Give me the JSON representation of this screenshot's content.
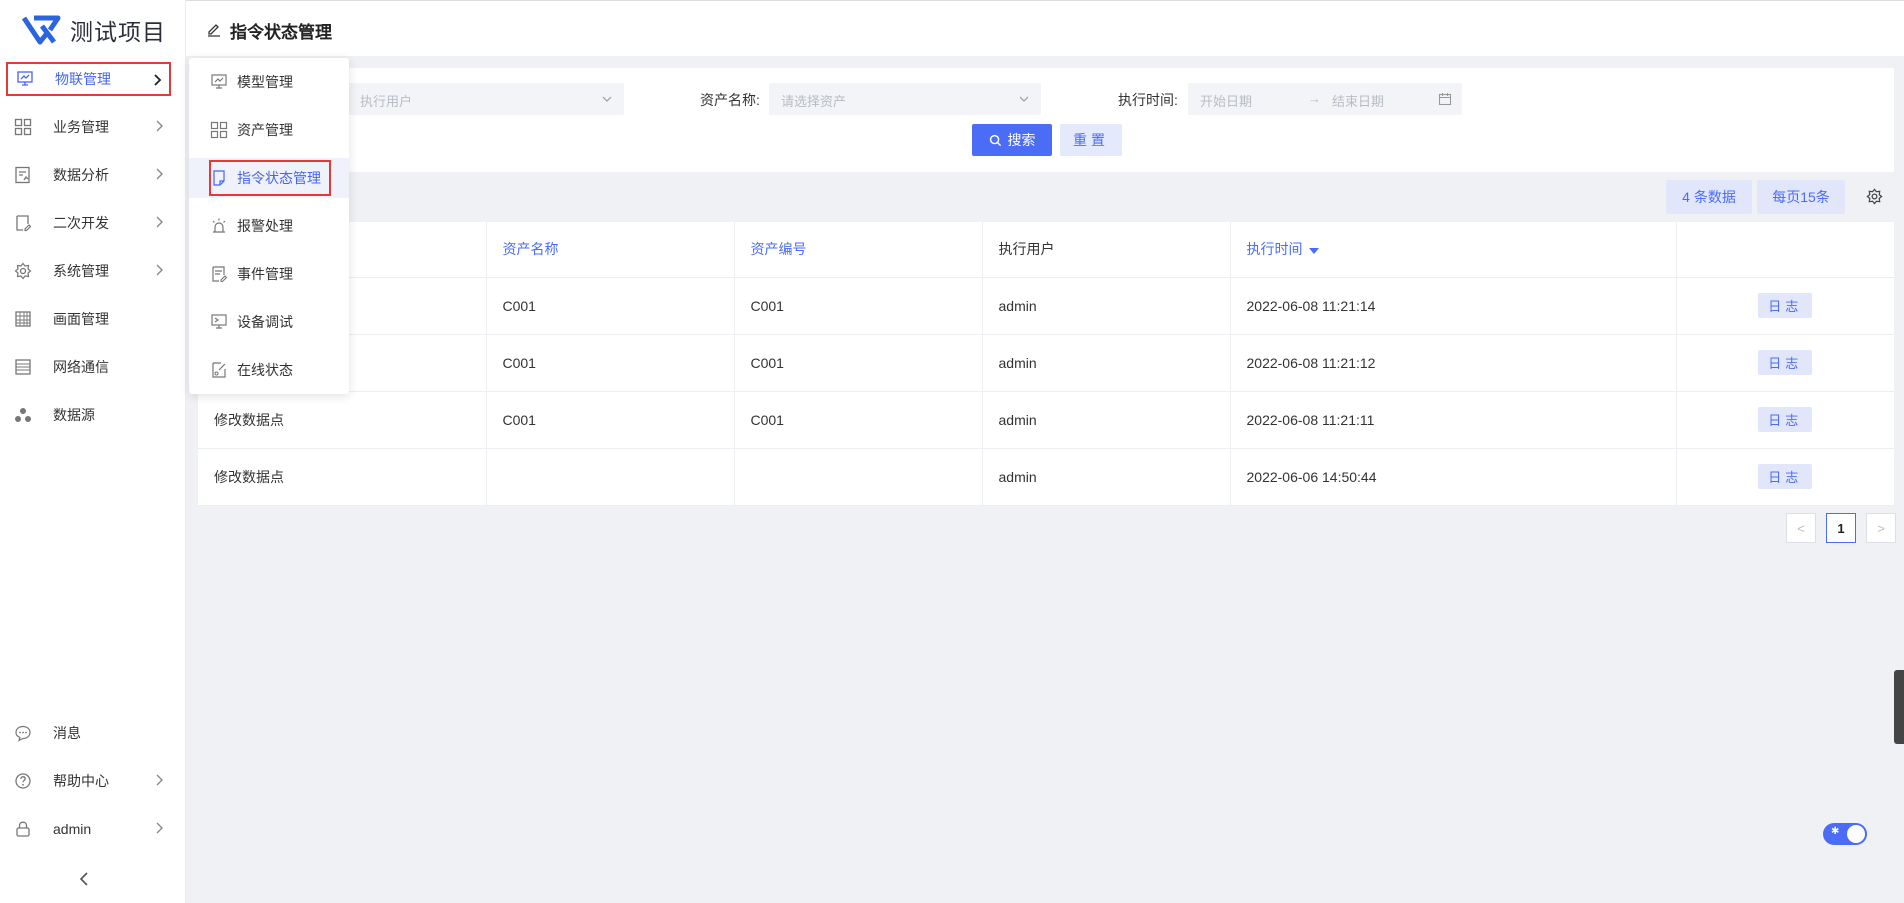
{
  "app": {
    "name": "测试项目"
  },
  "sidebar": {
    "items": [
      {
        "label": "物联管理",
        "icon": "iot-icon",
        "has_children": true,
        "active": true
      },
      {
        "label": "业务管理",
        "icon": "grid-icon",
        "has_children": true
      },
      {
        "label": "数据分析",
        "icon": "chart-doc-icon",
        "has_children": true
      },
      {
        "label": "二次开发",
        "icon": "dev-doc-icon",
        "has_children": true
      },
      {
        "label": "系统管理",
        "icon": "gear-icon",
        "has_children": true
      },
      {
        "label": "画面管理",
        "icon": "table-icon",
        "has_children": false
      },
      {
        "label": "网络通信",
        "icon": "list-icon",
        "has_children": false
      },
      {
        "label": "数据源",
        "icon": "cluster-icon",
        "has_children": false
      }
    ],
    "bottom": [
      {
        "label": "消息",
        "icon": "message-icon",
        "has_children": false
      },
      {
        "label": "帮助中心",
        "icon": "help-icon",
        "has_children": true
      },
      {
        "label": "admin",
        "icon": "lock-icon",
        "has_children": true
      }
    ]
  },
  "submenu": {
    "items": [
      {
        "label": "模型管理",
        "icon": "monitor-icon"
      },
      {
        "label": "资产管理",
        "icon": "grid-icon"
      },
      {
        "label": "指令状态管理",
        "icon": "doc-icon",
        "selected": true
      },
      {
        "label": "报警处理",
        "icon": "alarm-icon"
      },
      {
        "label": "事件管理",
        "icon": "event-icon"
      },
      {
        "label": "设备调试",
        "icon": "debug-icon"
      },
      {
        "label": "在线状态",
        "icon": "online-icon"
      }
    ]
  },
  "header": {
    "title": "指令状态管理"
  },
  "filters": {
    "user_placeholder": "执行用户",
    "asset_label": "资产名称:",
    "asset_placeholder": "请选择资产",
    "time_label": "执行时间:",
    "start_placeholder": "开始日期",
    "range_sep": "→",
    "end_placeholder": "结束日期",
    "search_label": "搜索",
    "reset_label": "重置"
  },
  "toolbar": {
    "count_label": "4 条数据",
    "page_size_label": "每页15条"
  },
  "table": {
    "columns": [
      "",
      "资产名称",
      "资产编号",
      "执行用户",
      "执行时间",
      ""
    ],
    "rows": [
      {
        "name": "",
        "asset_name": "C001",
        "asset_code": "C001",
        "user": "admin",
        "time": "2022-06-08 11:21:14",
        "action": "日志"
      },
      {
        "name": "",
        "asset_name": "C001",
        "asset_code": "C001",
        "user": "admin",
        "time": "2022-06-08 11:21:12",
        "action": "日志"
      },
      {
        "name": "修改数据点",
        "asset_name": "C001",
        "asset_code": "C001",
        "user": "admin",
        "time": "2022-06-08 11:21:11",
        "action": "日志"
      },
      {
        "name": "修改数据点",
        "asset_name": "",
        "asset_code": "",
        "user": "admin",
        "time": "2022-06-06 14:50:44",
        "action": "日志"
      }
    ]
  },
  "pagination": {
    "current": "1",
    "prev": "<",
    "next": ">"
  },
  "colors": {
    "accent": "#4a6cf7",
    "highlight": "#e53935"
  }
}
